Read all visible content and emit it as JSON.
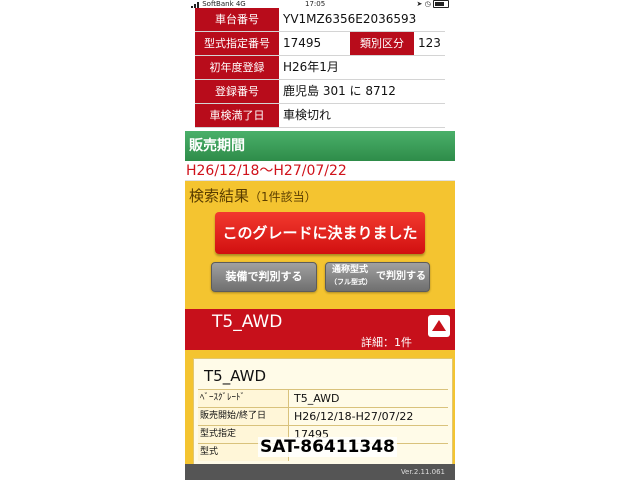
{
  "status": {
    "carrier": "SoftBank 4G",
    "time": "17:05"
  },
  "vehicle": {
    "rows": [
      {
        "label": "車台番号",
        "value": "YV1MZ6356E2036593"
      },
      {
        "label": "型式指定番号",
        "value": "17495",
        "label2": "類別区分",
        "value2": "123"
      },
      {
        "label": "初年度登録",
        "value": "H26年1月"
      },
      {
        "label": "登録番号",
        "value": "鹿児島 301 に 8712"
      },
      {
        "label": "車検満了日",
        "value": "車検切れ"
      }
    ]
  },
  "sales": {
    "header": "販売期間",
    "range": "H26/12/18〜H27/07/22"
  },
  "result": {
    "title": "検索結果",
    "count": "（1件該当）",
    "decide_label": "このグレードに決まりました",
    "equip_btn": "装備で判別する",
    "name_btn_main": "通称型式",
    "name_btn_sub": "（フル型式）",
    "name_btn_tail": "で判別する"
  },
  "grade": {
    "name": "T5_AWD",
    "detail": "詳細：1件"
  },
  "detail_card": {
    "title": "T5_AWD",
    "rows": [
      {
        "label": "ﾍﾞｰｽｸﾞﾚｰﾄﾞ",
        "value": "T5_AWD"
      },
      {
        "label": "販売開始/終了日",
        "value": "H26/12/18-H27/07/22"
      },
      {
        "label": "型式指定",
        "value": "17495"
      },
      {
        "label": "型式",
        "value": ""
      }
    ]
  },
  "watermark": "SAT-86411348",
  "footer": {
    "version": "Ver.2.11.061"
  }
}
